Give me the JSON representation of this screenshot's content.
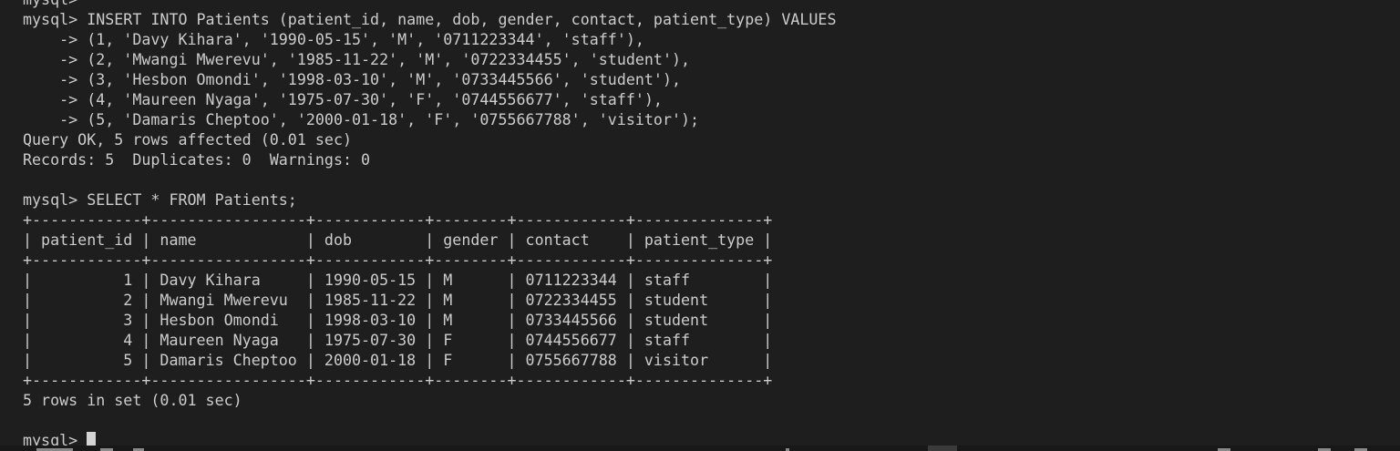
{
  "terminal": {
    "lines": [
      "mysql> ",
      "mysql> INSERT INTO Patients (patient_id, name, dob, gender, contact, patient_type) VALUES",
      "    -> (1, 'Davy Kihara', '1990-05-15', 'M', '0711223344', 'staff'),",
      "    -> (2, 'Mwangi Mwerevu', '1985-11-22', 'M', '0722334455', 'student'),",
      "    -> (3, 'Hesbon Omondi', '1998-03-10', 'M', '0733445566', 'student'),",
      "    -> (4, 'Maureen Nyaga', '1975-07-30', 'F', '0744556677', 'staff'),",
      "    -> (5, 'Damaris Cheptoo', '2000-01-18', 'F', '0755667788', 'visitor');",
      "Query OK, 5 rows affected (0.01 sec)",
      "Records: 5  Duplicates: 0  Warnings: 0",
      "",
      "mysql> SELECT * FROM Patients;",
      "+------------+-----------------+------------+--------+------------+--------------+",
      "| patient_id | name            | dob        | gender | contact    | patient_type |",
      "+------------+-----------------+------------+--------+------------+--------------+",
      "|          1 | Davy Kihara     | 1990-05-15 | M      | 0711223344 | staff        |",
      "|          2 | Mwangi Mwerevu  | 1985-11-22 | M      | 0722334455 | student      |",
      "|          3 | Hesbon Omondi   | 1998-03-10 | M      | 0733445566 | student      |",
      "|          4 | Maureen Nyaga   | 1975-07-30 | F      | 0744556677 | staff        |",
      "|          5 | Damaris Cheptoo | 2000-01-18 | F      | 0755667788 | visitor      |",
      "+------------+-----------------+------------+--------+------------+--------------+",
      "5 rows in set (0.01 sec)",
      ""
    ],
    "prompt": "mysql> ",
    "colors": {
      "background": "#1e1e1e",
      "foreground": "#cccccc",
      "cursor": "#d4d4d4"
    }
  }
}
